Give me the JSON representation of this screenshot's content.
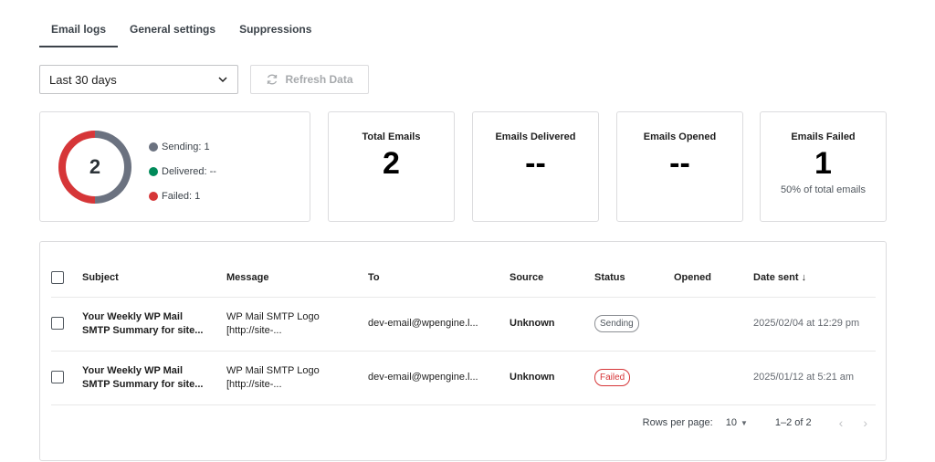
{
  "tabs": [
    {
      "label": "Email logs",
      "active": true
    },
    {
      "label": "General settings",
      "active": false
    },
    {
      "label": "Suppressions",
      "active": false
    }
  ],
  "filters": {
    "range_selected": "Last 30 days",
    "refresh_label": "Refresh Data"
  },
  "summary": {
    "total": "2",
    "legend": [
      {
        "label": "Sending: 1",
        "color": "#6b7280"
      },
      {
        "label": "Delivered: --",
        "color": "#008a5a"
      },
      {
        "label": "Failed: 1",
        "color": "#d63638"
      }
    ],
    "donut_fractions": {
      "sending": 0.5,
      "delivered": 0,
      "failed": 0.5
    }
  },
  "stats": [
    {
      "title": "Total Emails",
      "value": "2",
      "sub": ""
    },
    {
      "title": "Emails Delivered",
      "value": "--",
      "sub": ""
    },
    {
      "title": "Emails Opened",
      "value": "--",
      "sub": ""
    },
    {
      "title": "Emails Failed",
      "value": "1",
      "sub": "50% of total emails"
    }
  ],
  "table": {
    "headers": {
      "subject": "Subject",
      "message": "Message",
      "to": "To",
      "source": "Source",
      "status": "Status",
      "opened": "Opened",
      "date": "Date sent"
    },
    "rows": [
      {
        "subject_line1": "Your Weekly WP Mail",
        "subject_line2": "SMTP Summary for site...",
        "message_line1": "WP Mail SMTP Logo",
        "message_line2": "[http://site-...",
        "to": "dev-email@wpengine.l...",
        "source": "Unknown",
        "status": "Sending",
        "opened": "",
        "date": "2025/02/04 at 12:29 pm"
      },
      {
        "subject_line1": "Your Weekly WP Mail",
        "subject_line2": "SMTP Summary for site...",
        "message_line1": "WP Mail SMTP Logo",
        "message_line2": "[http://site-...",
        "to": "dev-email@wpengine.l...",
        "source": "Unknown",
        "status": "Failed",
        "opened": "",
        "date": "2025/01/12 at 5:21 am"
      }
    ]
  },
  "pagination": {
    "rows_per_page_label": "Rows per page:",
    "rows_per_page_value": "10",
    "range": "1–2 of 2"
  }
}
